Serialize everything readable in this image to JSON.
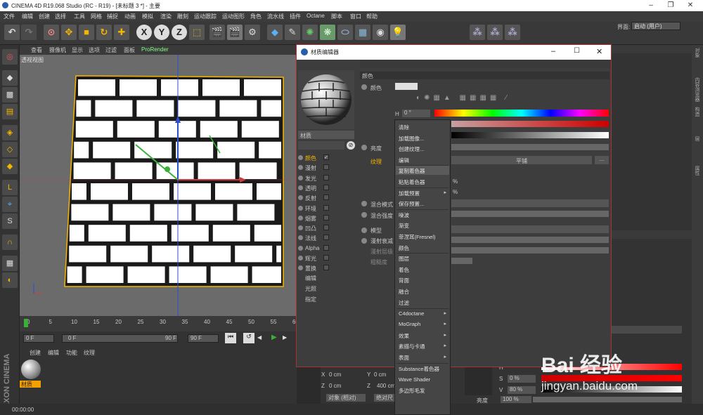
{
  "window": {
    "title": "CINEMA 4D R19.068 Studio (RC - R19) - [未标题 3 *] - 主要"
  },
  "menubar": {
    "items": [
      "文件",
      "编辑",
      "创建",
      "选择",
      "工具",
      "网格",
      "捕捉",
      "动画",
      "模拟",
      "渲染",
      "雕刻",
      "运动跟踪",
      "运动图形",
      "角色",
      "流水线",
      "插件",
      "Octane",
      "脚本",
      "窗口",
      "帮助"
    ],
    "layout_label": "界面:",
    "layout_value": "启动 (用户)"
  },
  "viewport": {
    "menu": [
      "查看",
      "摄像机",
      "显示",
      "选项",
      "过滤",
      "面板",
      "ProRender"
    ],
    "label": "透视视图"
  },
  "timeline": {
    "ticks": [
      "0",
      "5",
      "10",
      "15",
      "20",
      "25",
      "30",
      "35",
      "40",
      "45",
      "50",
      "55",
      "60"
    ],
    "start": "0 F",
    "current": "0 F",
    "end_a": "90 F",
    "end_b": "90 F"
  },
  "material_manager": {
    "menu": [
      "创建",
      "编辑",
      "功能",
      "纹理"
    ],
    "material_name": "材质"
  },
  "status": {
    "time": "00:00:00"
  },
  "mat_editor": {
    "title": "材质编辑器",
    "name_label": "材质",
    "channels": [
      {
        "label": "颜色",
        "checked": true
      },
      {
        "label": "漫射",
        "checked": false
      },
      {
        "label": "发光",
        "checked": false
      },
      {
        "label": "透明",
        "checked": false
      },
      {
        "label": "反射",
        "checked": false
      },
      {
        "label": "环境",
        "checked": false
      },
      {
        "label": "烟雾",
        "checked": false
      },
      {
        "label": "凹凸",
        "checked": false
      },
      {
        "label": "法线",
        "checked": false
      },
      {
        "label": "Alpha",
        "checked": false
      },
      {
        "label": "辉光",
        "checked": false
      },
      {
        "label": "置换",
        "checked": false
      }
    ],
    "extra": [
      "编辑",
      "光照",
      "指定"
    ],
    "section": "颜色",
    "color_label": "颜色",
    "h_label": "H",
    "h_value": "0 °",
    "brightness_label": "亮度",
    "texture_label": "纹理",
    "texture_button": "平铺",
    "blend_mode": "混合模式",
    "blend_strength": "混合强度",
    "model": "模型",
    "diffuse_falloff": "漫射衰减",
    "diffuse_level": "漫射层级",
    "roughness": "粗糙度",
    "pct1": "%",
    "pct2": "%"
  },
  "context_menu": {
    "items": [
      {
        "label": "清除",
        "arrow": false
      },
      {
        "label": "加载图像...",
        "arrow": false
      },
      {
        "label": "创建纹理...",
        "arrow": false
      },
      {
        "label": "编辑",
        "arrow": false
      },
      {
        "label": "复制着色器",
        "arrow": false,
        "highlight": true
      },
      {
        "label": "粘贴着色器",
        "arrow": false
      },
      {
        "label": "加载预置",
        "arrow": true
      },
      {
        "label": "保存预置...",
        "arrow": false
      },
      {
        "label": "噪波",
        "arrow": false
      },
      {
        "label": "渐变",
        "arrow": false
      },
      {
        "label": "菲涅耳(Fresnel)",
        "arrow": false
      },
      {
        "label": "颜色",
        "arrow": false
      },
      {
        "label": "图层",
        "arrow": false
      },
      {
        "label": "着色",
        "arrow": false
      },
      {
        "label": "背面",
        "arrow": false
      },
      {
        "label": "融合",
        "arrow": false
      },
      {
        "label": "过滤",
        "arrow": false
      },
      {
        "label": "C4doctane",
        "arrow": true
      },
      {
        "label": "MoGraph",
        "arrow": true
      },
      {
        "label": "效果",
        "arrow": true
      },
      {
        "label": "素描与卡通",
        "arrow": true
      },
      {
        "label": "表面",
        "arrow": true
      },
      {
        "label": "Substance着色器",
        "arrow": false
      },
      {
        "label": "Wave Shader",
        "arrow": false
      },
      {
        "label": "多边形毛发",
        "arrow": false
      }
    ]
  },
  "coords": {
    "x1": "0 cm",
    "y1": "0 cm",
    "x2": "0 cm",
    "y2": "400 cm",
    "mode": "对象 (相对)",
    "apply": "绝对尺"
  },
  "hsv": {
    "h": "H",
    "s": "S",
    "s_value": "0 %",
    "v": "V",
    "v_value": "80 %",
    "brightness": "亮度",
    "brightness_value": "100 %"
  },
  "right_tabs": [
    "对象",
    "内容浏览器",
    "构造",
    "层",
    "属性"
  ],
  "watermark": {
    "brand": "Bai 经验",
    "url": "jingyan.baidu.com"
  }
}
